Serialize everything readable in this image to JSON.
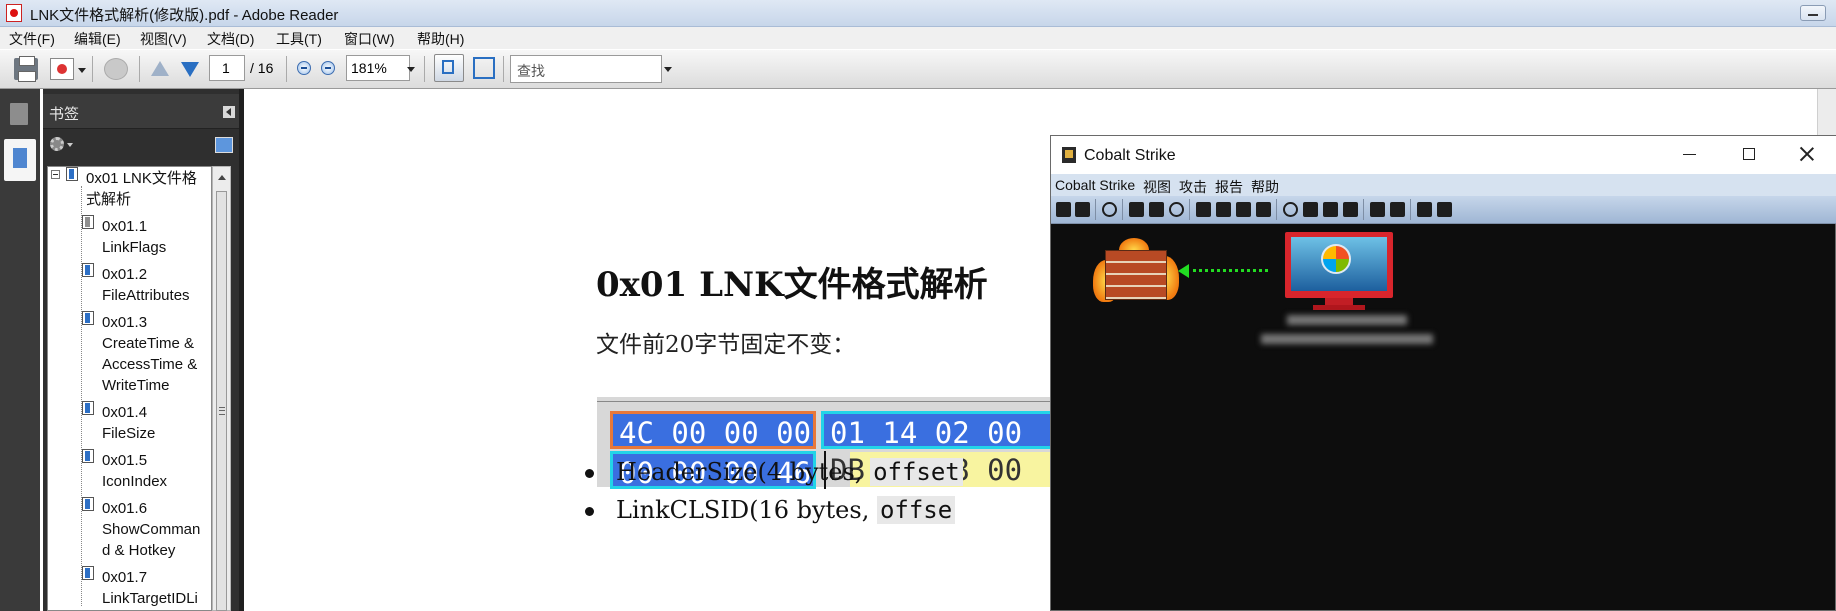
{
  "reader": {
    "window_title": "LNK文件格式解析(修改版).pdf - Adobe Reader",
    "menu": [
      "文件(F)",
      "编辑(E)",
      "视图(V)",
      "文档(D)",
      "工具(T)",
      "窗口(W)",
      "帮助(H)"
    ],
    "toolbar": {
      "current_page": "1",
      "page_total": "/ 16",
      "zoom": "181%",
      "find_placeholder": "查找"
    },
    "bookmarks": {
      "panel_title": "书签",
      "items": [
        {
          "label_lines": [
            "0x01 LNK文件格",
            "式解析"
          ],
          "icon": "bookmark-icon"
        },
        {
          "label_lines": [
            "0x01.1",
            "LinkFlags"
          ],
          "icon": "bookmark-grey-icon"
        },
        {
          "label_lines": [
            "0x01.2",
            "FileAttributes"
          ],
          "icon": "bookmark-icon"
        },
        {
          "label_lines": [
            "0x01.3",
            "CreateTime &",
            "AccessTime &",
            "WriteTime"
          ],
          "icon": "bookmark-icon"
        },
        {
          "label_lines": [
            "0x01.4",
            "FileSize"
          ],
          "icon": "bookmark-icon"
        },
        {
          "label_lines": [
            "0x01.5",
            "IconIndex"
          ],
          "icon": "bookmark-icon"
        },
        {
          "label_lines": [
            "0x01.6",
            "ShowComman",
            "d & Hotkey"
          ],
          "icon": "bookmark-icon"
        },
        {
          "label_lines": [
            "0x01.7",
            "LinkTargetIDLi"
          ],
          "icon": "bookmark-icon"
        }
      ]
    },
    "document": {
      "heading": "0x01 LNK文件格式解析",
      "paragraph": "文件前20字节固定不变：",
      "hex_rows": [
        {
          "cells": [
            "4C 00 00 00",
            "01 14 02 00"
          ],
          "colors": [
            "#e8783a",
            "#22d4e8"
          ]
        },
        {
          "cells": [
            "00 00 00 46",
            "DB 02 08 00"
          ],
          "colors": [
            "#22d4e8",
            ""
          ]
        }
      ],
      "bullets": [
        {
          "text": "HeaderSize(4 bytes, ",
          "code": "offset"
        },
        {
          "text": "LinkCLSID(16 bytes, ",
          "code": "offse"
        }
      ]
    }
  },
  "cobalt_strike": {
    "title": "Cobalt Strike",
    "menu": [
      "Cobalt Strike",
      "视图",
      "攻击",
      "报告",
      "帮助"
    ],
    "toolbar_icons": [
      "plus-icon",
      "minus-icon",
      "headphones-icon",
      "targets-icon",
      "list-icon",
      "crosshair-icon",
      "screenshot-icon",
      "download-icon",
      "key-icon",
      "image-icon",
      "gear-icon",
      "coffee-icon",
      "document-icon",
      "terminal-icon",
      "link-icon",
      "cloud-icon",
      "book-icon",
      "cube-icon"
    ],
    "graph": {
      "link_color": "#22dd22"
    }
  }
}
